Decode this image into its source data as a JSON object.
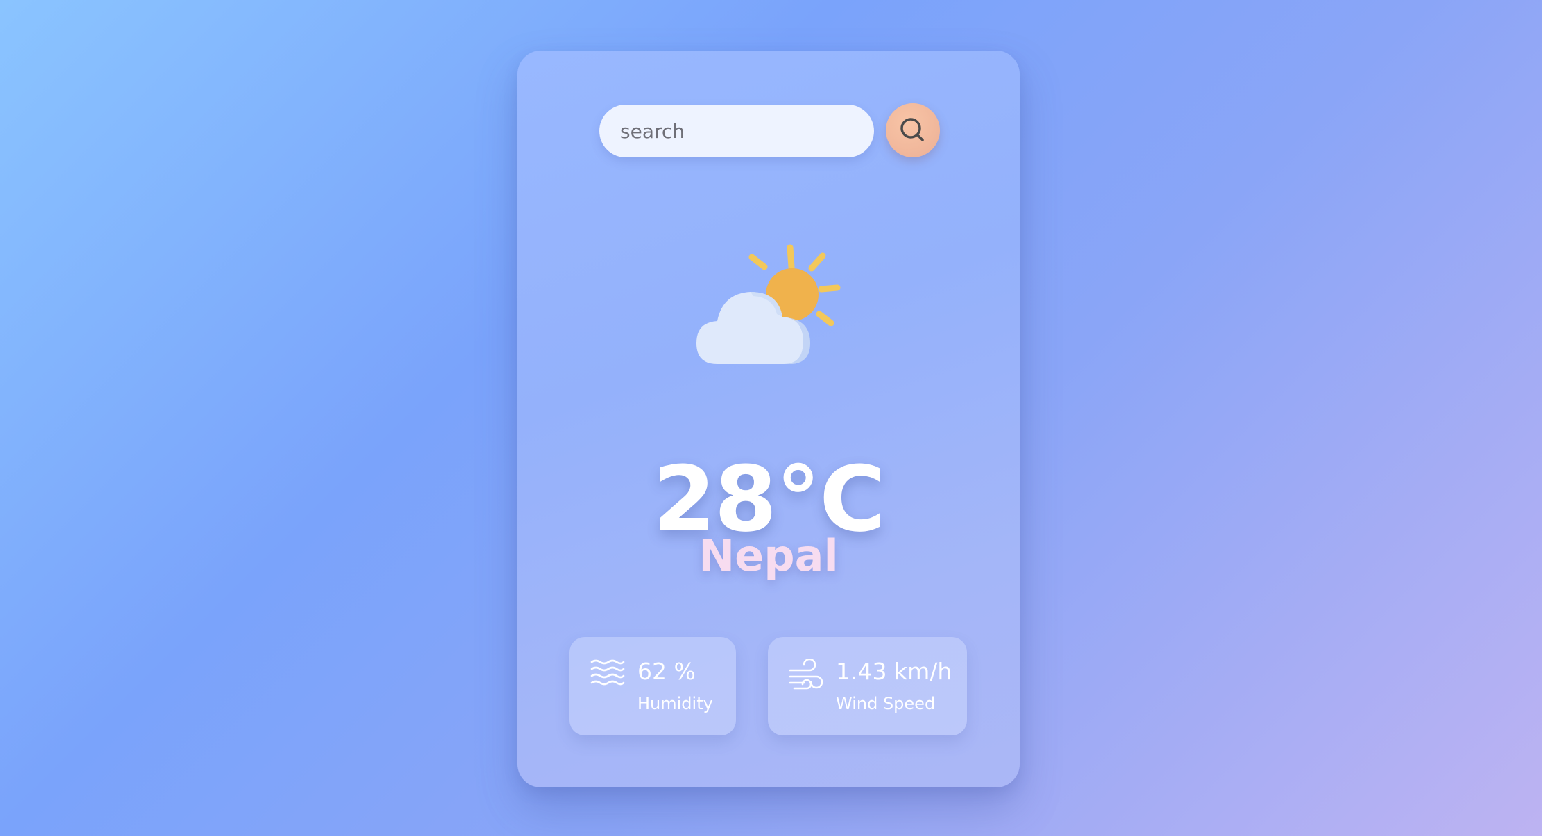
{
  "search": {
    "placeholder": "search",
    "button_icon": "search-icon"
  },
  "weather": {
    "icon": "partly-cloudy-icon",
    "temperature": "28°C",
    "city": "Nepal"
  },
  "stats": {
    "humidity": {
      "icon": "humidity-icon",
      "value": "62 %",
      "label": "Humidity"
    },
    "wind": {
      "icon": "wind-icon",
      "value": "1.43 km/h",
      "label": "Wind Speed"
    }
  },
  "colors": {
    "background_start": "#8ac4ff",
    "background_end": "#bdb3f2",
    "card": "#98b8ff",
    "search_button": "#f1b89c",
    "sun": "#f0b24c",
    "city_text": "#f7dcf0",
    "temperature_text": "#ffffff"
  }
}
